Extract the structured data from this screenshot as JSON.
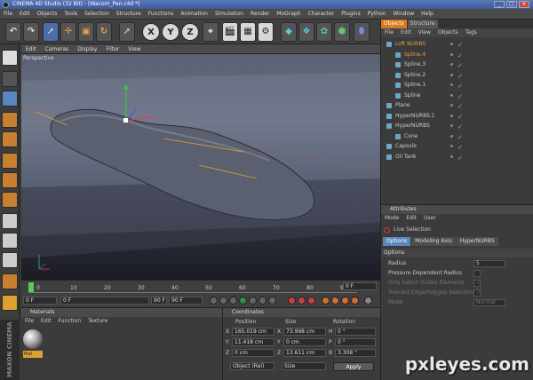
{
  "window": {
    "title": "CINEMA 4D Studio (32 Bit) - [Wacom_Pen.c4d *]"
  },
  "menu": [
    "File",
    "Edit",
    "Objects",
    "Tools",
    "Selection",
    "Structure",
    "Functions",
    "Animation",
    "Simulation",
    "Render",
    "MoGraph",
    "Character",
    "Plugins",
    "Python",
    "Window",
    "Help"
  ],
  "toolbar": {
    "axis_x": "X",
    "axis_y": "Y",
    "axis_z": "Z"
  },
  "viewport": {
    "menu": [
      "Edit",
      "Cameras",
      "Display",
      "Filter",
      "View"
    ],
    "label": "Perspective"
  },
  "timeline": {
    "ticks": [
      "0",
      "10",
      "20",
      "30",
      "40",
      "50",
      "60",
      "70",
      "80",
      "90"
    ],
    "current_frame": "0 F",
    "start": "0 F",
    "start2": "0 F",
    "end": "90 F",
    "end2": "90 F"
  },
  "materials": {
    "title": "Materials",
    "menu": [
      "File",
      "Edit",
      "Function",
      "Texture"
    ],
    "items": [
      {
        "name": "Mat"
      }
    ]
  },
  "coordinates": {
    "title": "Coordinates",
    "headers": [
      "Position",
      "Size",
      "Rotation"
    ],
    "rows": [
      {
        "axis": "X",
        "pos": "165.019 cm",
        "size_axis": "X",
        "size": "73.998 cm",
        "rot_axis": "H",
        "rot": "0 °"
      },
      {
        "axis": "Y",
        "pos": "11.418 cm",
        "size_axis": "Y",
        "size": "0 cm",
        "rot_axis": "P",
        "rot": "0 °"
      },
      {
        "axis": "Z",
        "pos": "0 cm",
        "size_axis": "Z",
        "size": "13.611 cm",
        "rot_axis": "B",
        "rot": "3.308 °"
      }
    ],
    "mode": "Object (Rel)",
    "size_mode": "Size",
    "apply": "Apply"
  },
  "objects": {
    "tabs": [
      "Objects",
      "Structure"
    ],
    "menu": [
      "File",
      "Edit",
      "View",
      "Objects",
      "Tags"
    ],
    "items": [
      {
        "name": "Loft NURBS",
        "indent": 0,
        "color": "#e8a040"
      },
      {
        "name": "Spline.4",
        "indent": 1,
        "color": "#e8a040"
      },
      {
        "name": "Spline.3",
        "indent": 1,
        "color": "#ccc"
      },
      {
        "name": "Spline.2",
        "indent": 1,
        "color": "#ccc"
      },
      {
        "name": "Spline.1",
        "indent": 1,
        "color": "#ccc"
      },
      {
        "name": "Spline",
        "indent": 1,
        "color": "#ccc"
      },
      {
        "name": "Plane",
        "indent": 0,
        "color": "#ccc"
      },
      {
        "name": "HyperNURBS.1",
        "indent": 0,
        "color": "#ccc"
      },
      {
        "name": "HyperNURBS",
        "indent": 0,
        "color": "#ccc"
      },
      {
        "name": "Cone",
        "indent": 1,
        "color": "#ccc"
      },
      {
        "name": "Capsule",
        "indent": 0,
        "color": "#ccc"
      },
      {
        "name": "Oil Tank",
        "indent": 0,
        "color": "#ccc"
      }
    ]
  },
  "attributes": {
    "title": "Attributes",
    "menu": [
      "Mode",
      "Edit",
      "User"
    ],
    "tool": "Live Selection",
    "tabs": [
      "Options",
      "Modeling Axis",
      "HyperNURBS"
    ],
    "section": "Options",
    "fields": [
      {
        "label": "Radius",
        "value": "5",
        "enabled": true
      },
      {
        "label": "Pressure Dependent Radius",
        "value": "",
        "enabled": true
      },
      {
        "label": "Only Select Visible Elements",
        "value": "✓",
        "enabled": false
      },
      {
        "label": "Tolerant Edge/Polygon Selection",
        "value": "✓",
        "enabled": false
      },
      {
        "label": "Mode",
        "value": "Normal",
        "enabled": false
      }
    ]
  },
  "branding": {
    "maxon": "MAXON CINEMA 4D"
  },
  "watermark": "pxleyes.com",
  "colors": {
    "accent": "#d77b20",
    "selection": "#5a86c0"
  }
}
